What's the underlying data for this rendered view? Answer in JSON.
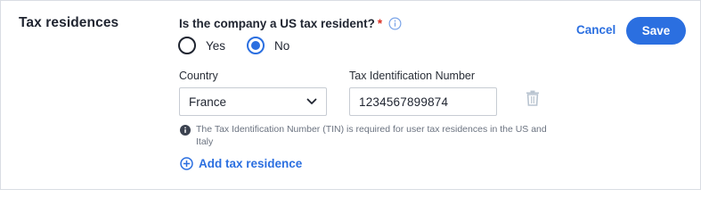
{
  "section": {
    "title": "Tax residences"
  },
  "question": {
    "text": "Is the company a US tax resident?",
    "required_mark": "*"
  },
  "radio_options": [
    {
      "label": "Yes",
      "checked": false
    },
    {
      "label": "No",
      "checked": true
    }
  ],
  "country": {
    "label": "Country",
    "value": "France"
  },
  "tin": {
    "label": "Tax Identification Number",
    "value": "1234567899874"
  },
  "help_text": "The Tax Identification Number (TIN) is required for user tax residences in the US and Italy",
  "add_residence": {
    "label": "Add tax residence"
  },
  "actions": {
    "cancel": "Cancel",
    "save": "Save"
  },
  "colors": {
    "accent": "#2b6fe0",
    "required": "#d92d20",
    "muted_text": "#6b7380",
    "border": "#c7ccd3"
  },
  "icons": [
    "info-outline-icon",
    "chevron-down-icon",
    "trash-icon",
    "info-filled-icon",
    "plus-circle-icon"
  ]
}
